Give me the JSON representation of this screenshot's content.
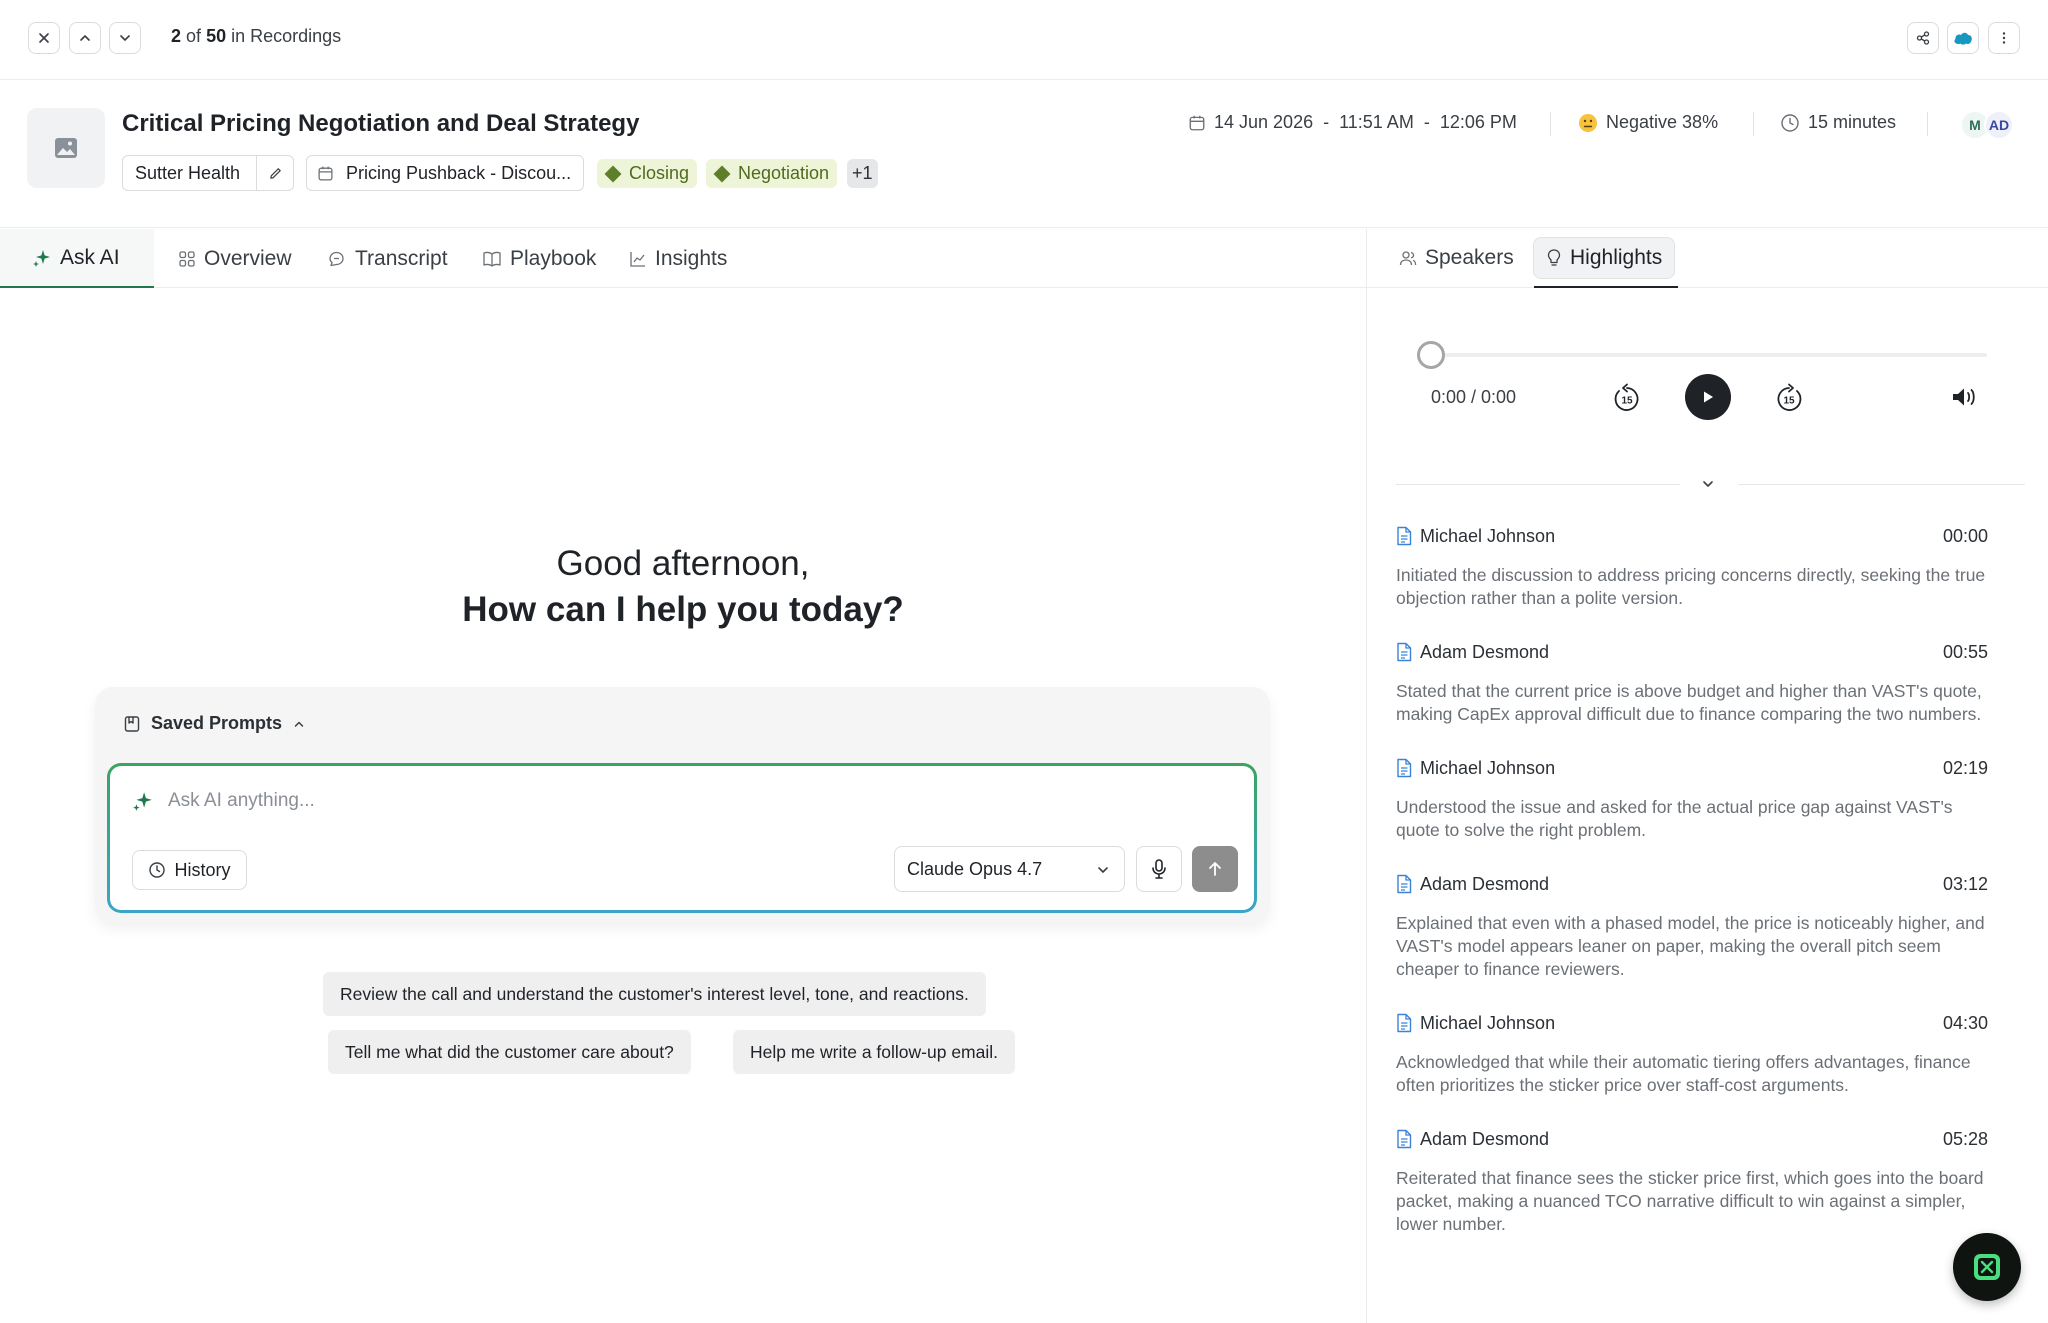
{
  "topbar": {
    "position": "2",
    "of_label": "of",
    "total": "50",
    "in_label": "in Recordings",
    "icons": [
      "close-icon",
      "chevron-up-icon",
      "chevron-down-icon",
      "share-icon",
      "salesforce-icon",
      "more-vertical-icon"
    ]
  },
  "header": {
    "title": "Critical Pricing Negotiation and Deal Strategy",
    "account": "Sutter Health",
    "meeting": "Pricing Pushback - Discou...",
    "tags": [
      "Closing",
      "Negotiation"
    ],
    "more_tags": "+1",
    "date": "14 Jun 2026",
    "start_time": "11:51 AM",
    "end_time": "12:06 PM",
    "time_sep": "-",
    "sentiment": "Negative 38%",
    "duration": "15 minutes",
    "avatars": [
      "M",
      "AD"
    ]
  },
  "tabs": [
    "Ask AI",
    "Overview",
    "Transcript",
    "Playbook",
    "Insights"
  ],
  "right_tabs": [
    "Speakers",
    "Highlights"
  ],
  "main": {
    "greeting": "Good afternoon,",
    "prompt_heading": "How can I help you today?",
    "saved_prompts_label": "Saved Prompts",
    "input_placeholder": "Ask AI anything...",
    "history_label": "History",
    "model": "Claude Opus 4.7",
    "suggestions": [
      "Review the call and understand the customer's interest level, tone, and reactions.",
      "Tell me what did the customer care about?",
      "Help me write a follow-up email."
    ]
  },
  "player": {
    "time": "0:00 / 0:00",
    "skip_back": "15",
    "skip_forward": "15",
    "progress": 0
  },
  "highlights": [
    {
      "speaker": "Michael Johnson",
      "time": "00:00",
      "text": "Initiated the discussion to address pricing concerns directly, seeking the true objection rather than a polite version."
    },
    {
      "speaker": "Adam Desmond",
      "time": "00:55",
      "text": "Stated that the current price is above budget and higher than VAST's quote, making CapEx approval difficult due to finance comparing the two numbers."
    },
    {
      "speaker": "Michael Johnson",
      "time": "02:19",
      "text": "Understood the issue and asked for the actual price gap against VAST's quote to solve the right problem."
    },
    {
      "speaker": "Adam Desmond",
      "time": "03:12",
      "text": "Explained that even with a phased model, the price is noticeably higher, and VAST's model appears leaner on paper, making the overall pitch seem cheaper to finance reviewers."
    },
    {
      "speaker": "Michael Johnson",
      "time": "04:30",
      "text": "Acknowledged that while their automatic tiering offers advantages, finance often prioritizes the sticker price over staff-cost arguments."
    },
    {
      "speaker": "Adam Desmond",
      "time": "05:28",
      "text": "Reiterated that finance sees the sticker price first, which goes into the board packet, making a nuanced TCO narrative difficult to win against a simpler, lower number."
    }
  ],
  "colors": {
    "accent": "#1e7a4c",
    "tag_bg": "#eef4d8",
    "tag_text": "#4f6b1f",
    "salesforce": "#1798c1"
  }
}
